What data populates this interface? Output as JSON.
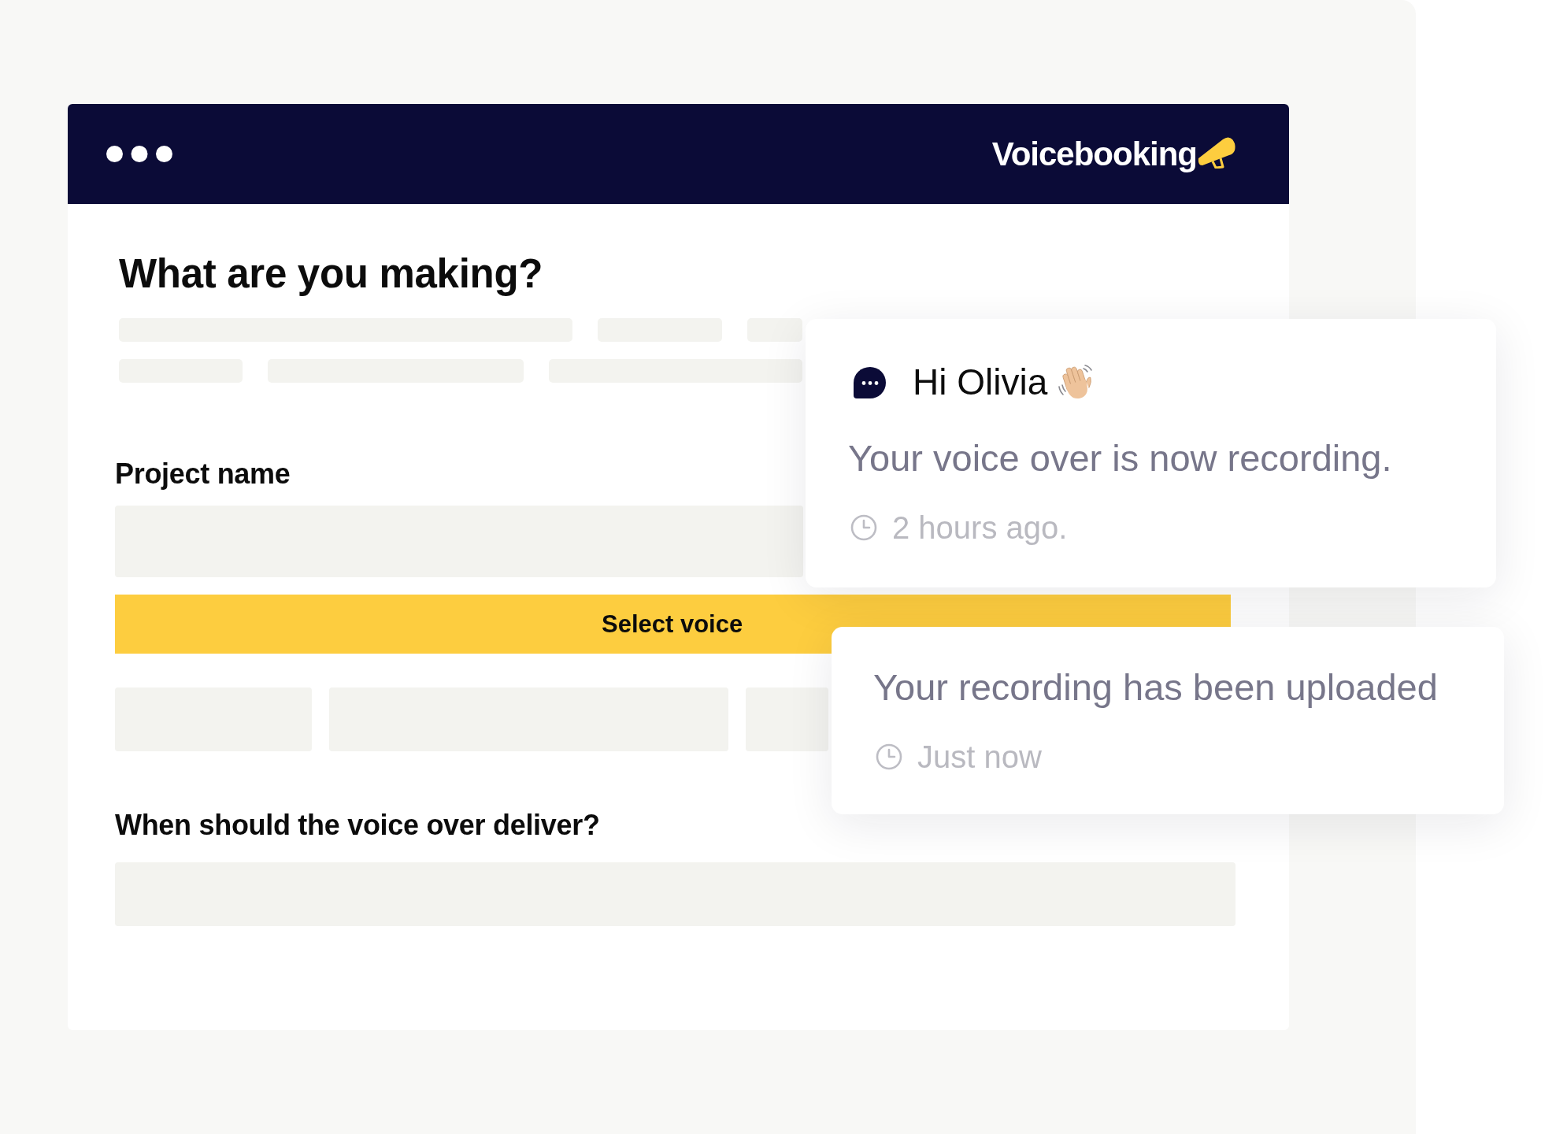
{
  "header": {
    "brand": "Voicebooking"
  },
  "form": {
    "title": "What are you making?",
    "project_name": {
      "label": "Project name"
    },
    "select_button": "Select voice",
    "delivery": {
      "label": "When should the voice over deliver?"
    }
  },
  "notifications": [
    {
      "kind": "greeting",
      "greeting": "Hi Olivia",
      "message": "Your voice over is now recording.",
      "time": "2 hours ago."
    },
    {
      "kind": "plain",
      "message": "Your recording has been uploaded",
      "time": "Just now"
    }
  ]
}
